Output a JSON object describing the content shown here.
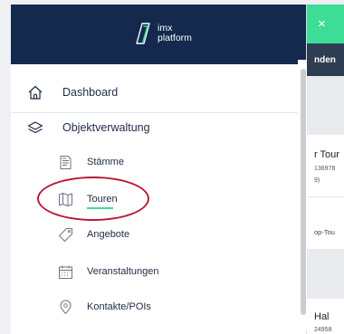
{
  "logo": {
    "line1": "imx",
    "line2": "platform"
  },
  "menu": {
    "dashboard": "Dashboard",
    "objektverwaltung": "Objektverwaltung",
    "staemme": "Stämme",
    "touren": "Touren",
    "angebote": "Angebote",
    "veranstaltungen": "Veranstaltungen",
    "kontakte": "Kontakte/POIs"
  },
  "background": {
    "close_symbol": "×",
    "tab_label": "nden",
    "row1_title": "r Tour",
    "row1_sub": "136978",
    "row1_sub2": "9)",
    "row2_title": "op-Tou",
    "row3_title": "Hal",
    "row3_sub": "24958"
  },
  "colors": {
    "header_bg": "#14294d",
    "accent_green": "#3ddc97",
    "annotation_red": "#b8193a"
  }
}
